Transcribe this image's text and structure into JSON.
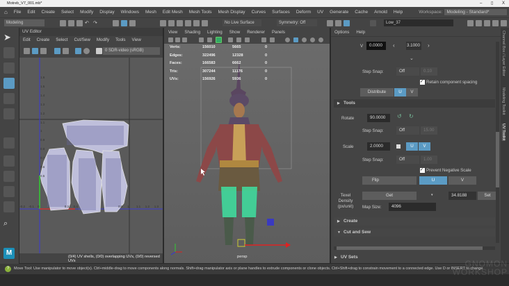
{
  "window": {
    "title": "Motreb_V7_001.mb*",
    "min": "–",
    "max": "▯",
    "close": "X"
  },
  "menu": [
    "File",
    "Edit",
    "Create",
    "Select",
    "Modify",
    "Display",
    "Windows",
    "Mesh",
    "Edit Mesh",
    "Mesh Tools",
    "Mesh Display",
    "Curves",
    "Surfaces",
    "Deform",
    "UV",
    "Generate",
    "Cache",
    "Arnold",
    "Help"
  ],
  "workspace": {
    "label": "Workspace:",
    "value": "Modeling - Standard*"
  },
  "toolbar": {
    "mode": "Modeling",
    "live_surface": "No Live Surface",
    "symmetry": "Symmetry: Off",
    "object_name": "Low_37"
  },
  "uv_editor": {
    "title": "UV Editor",
    "menu": [
      "Edit",
      "Create",
      "Select",
      "Cut/Sew",
      "Modify",
      "Tools",
      "View"
    ],
    "colorspace": "0 SDR-video (sRGB)",
    "v_ticks": [
      "1.6",
      "1.5",
      "1.4",
      "1.3",
      "1.2",
      "1.1",
      "1",
      "0.9",
      "0.8",
      "0.7",
      "0.6",
      "0.5"
    ],
    "u_ticks": [
      "-0.2",
      "-0.1",
      "0",
      "0.3",
      "0.4",
      "0.9",
      "1",
      "1.1",
      "1.2",
      "1.3"
    ],
    "status": "(0/4) UV shells, (0/0) overlapping UVs, (0/0) reversed UVs"
  },
  "viewport": {
    "menu": [
      "View",
      "Shading",
      "Lighting",
      "Show",
      "Renderer",
      "Panels"
    ],
    "stats": [
      {
        "label": "Verts:",
        "a": "156010",
        "b": "5665",
        "c": "0"
      },
      {
        "label": "Edges:",
        "a": "322496",
        "b": "12328",
        "c": "0"
      },
      {
        "label": "Faces:",
        "a": "166583",
        "b": "6662",
        "c": "0"
      },
      {
        "label": "Tris:",
        "a": "307244",
        "b": "11176",
        "c": "0"
      },
      {
        "label": "UVs:",
        "a": "156926",
        "b": "5936",
        "c": "0"
      }
    ],
    "camera": "persp"
  },
  "uv_toolkit": {
    "menu": [
      "Options",
      "Help"
    ],
    "v_label": "V",
    "v_value": "0.0000",
    "v_step": "3.1000",
    "step_snap_label": "Step Snap:",
    "off": "Off",
    "snap1": "0.10",
    "retain": "Retain component spacing",
    "distribute": "Distribute",
    "u": "U",
    "v": "V",
    "tools_section": "Tools",
    "rotate_label": "Rotate",
    "rotate_value": "90.0000",
    "snap2": "15.00",
    "scale_label": "Scale",
    "scale_value": "2.0000",
    "snap3": "1.00",
    "prevent_neg": "Prevent Negative Scale",
    "flip": "Flip",
    "texel_label": "Texel Density (px/unit)",
    "get": "Get",
    "texel_value": "34.8188",
    "set": "Set",
    "map_size_label": "Map Size:",
    "map_size": "4096",
    "create_section": "Create",
    "cut_sew_section": "Cut and Sew",
    "uv_sets_section": "UV Sets"
  },
  "side_tabs": [
    "Channel Box / Layer Editor",
    "Modeling Toolkit",
    "UV Toolkit"
  ],
  "status_line": "Move Tool: Use manipulator to move object(s). Ctrl+middle-drag to move components along normals. Shift+drag manipulator axis or plane handles to extrude components or clone objects. Ctrl+Shift+drag to constrain movement to a connected edge. Use D or INSERT to change",
  "watermark": "GNOMON WORKSHOP"
}
